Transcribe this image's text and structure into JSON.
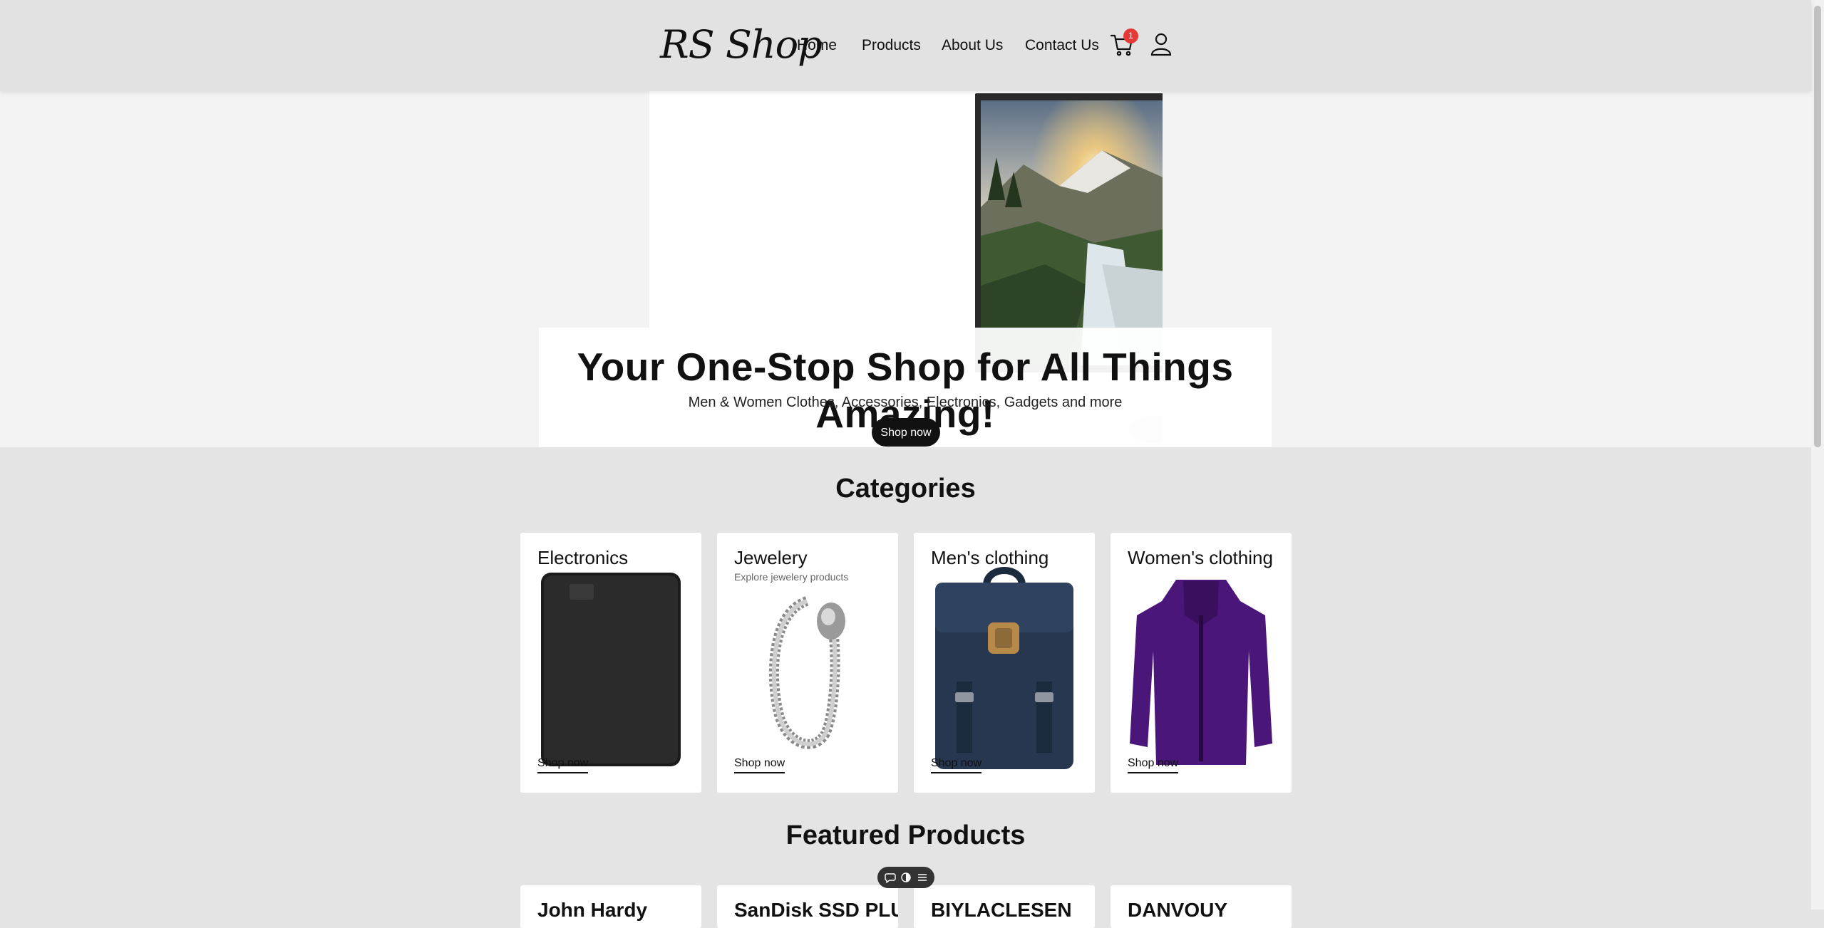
{
  "header": {
    "logo": "RS Shop",
    "nav": [
      "Home",
      "Products",
      "About Us",
      "Contact Us"
    ],
    "cart_count": "1",
    "cart_icon": "cart-icon",
    "user_icon": "user-icon"
  },
  "hero": {
    "title": "Your One-Stop Shop for All Things Amazing!",
    "subtitle": "Men & Women Clothes, Accessories, Electronics, Gadgets and more",
    "button": "Shop now"
  },
  "categories": {
    "title": "Categories",
    "items": [
      {
        "name": "Electronics",
        "description": "",
        "link": "Shop now"
      },
      {
        "name": "Jewelery",
        "description": "Explore jewelery products",
        "link": "Shop now"
      },
      {
        "name": "Men's clothing",
        "description": "",
        "link": "Shop now"
      },
      {
        "name": "Women's clothing",
        "description": "",
        "link": "Shop now"
      }
    ]
  },
  "featured": {
    "title": "Featured Products",
    "items": [
      "John Hardy",
      "SanDisk SSD PLUS",
      "BIYLACLESEN",
      "DANVOUY"
    ]
  },
  "toolbar": {
    "icons": [
      "chat-bubble-icon",
      "toggle-icon",
      "list-icon"
    ]
  },
  "colors": {
    "header_bg": "#e2e2e2",
    "page_bg": "#e4e4e4",
    "badge": "#e53935",
    "button": "#111111"
  }
}
